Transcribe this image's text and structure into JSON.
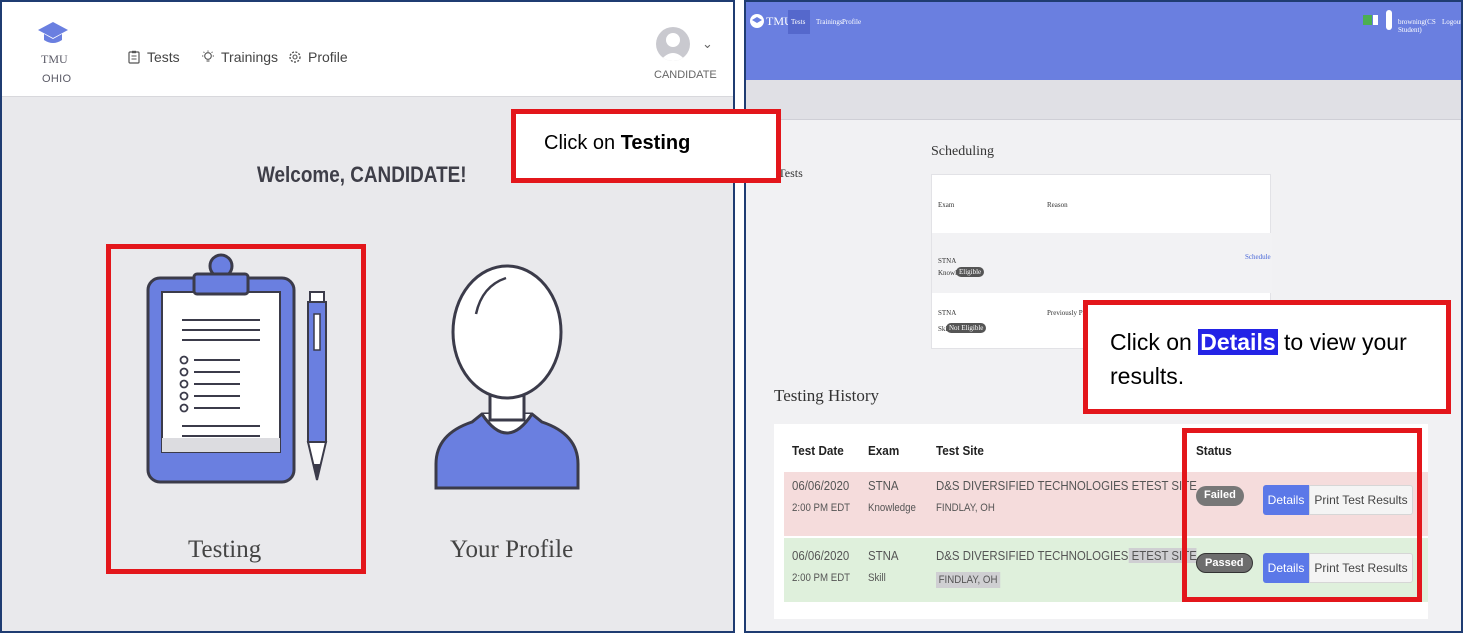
{
  "left_app": {
    "logo": {
      "name": "TMU",
      "sub": "OHIO"
    },
    "nav": [
      {
        "label": "Tests",
        "icon": "clipboard-icon"
      },
      {
        "label": "Trainings",
        "icon": "lightbulb-icon"
      },
      {
        "label": "Profile",
        "icon": "gear-icon"
      }
    ],
    "user": {
      "name": "CANDIDATE"
    },
    "welcome": "Welcome, CANDIDATE!",
    "tiles": [
      {
        "label": "Testing",
        "icon": "clipboard-icon"
      },
      {
        "label": "Your Profile",
        "icon": "person-icon"
      }
    ]
  },
  "right_app": {
    "logo": "TMU",
    "nav": [
      "Tests",
      "Trainings",
      "Profile"
    ],
    "user_label": "browning(CS Student)",
    "logout": "Logout",
    "page_title": "Your Tests",
    "scheduling": {
      "title": "Scheduling",
      "headers": [
        "Exam",
        "Reason"
      ],
      "rows": [
        {
          "exam": "STNA",
          "type": "Knowledge",
          "badge": "Eligible",
          "reason": "",
          "action": "Schedule"
        },
        {
          "exam": "STNA",
          "type": "Skill",
          "badge": "Not Eligible",
          "reason": "Previously Passed",
          "action": ""
        }
      ]
    },
    "history": {
      "title": "Testing History",
      "headers": [
        "Test Date",
        "Exam",
        "Test Site",
        "Status"
      ],
      "rows": [
        {
          "date": "06/06/2020",
          "time": "2:00 PM EDT",
          "exam": "STNA",
          "type": "Knowledge",
          "site": "D&S DIVERSIFIED TECHNOLOGIES ETEST SITE",
          "city": "FINDLAY, OH",
          "status": "Failed",
          "details": "Details",
          "print": "Print Test Results"
        },
        {
          "date": "06/06/2020",
          "time": "2:00 PM EDT",
          "exam": "STNA",
          "type": "Skill",
          "site": "D&S DIVERSIFIED TECHNOLOGIES ETEST SITE",
          "site_part1": "D&S DIVERSIFIED TECHNOLOGIES",
          "site_part2": " ETEST SITE",
          "city": "FINDLAY, OH",
          "status": "Passed",
          "details": "Details",
          "print": "Print Test Results"
        }
      ]
    }
  },
  "callouts": {
    "testing": {
      "prefix": "Click on ",
      "bold": "Testing"
    },
    "details": {
      "prefix": "Click on ",
      "bold": "Details",
      "suffix": " to view your results."
    }
  },
  "colors": {
    "accent_blue": "#5b78e8",
    "header_blue": "#6a7fe0",
    "callout_red": "#e3161b",
    "failed_row": "#f5dcdc",
    "passed_row": "#dff0dc"
  }
}
